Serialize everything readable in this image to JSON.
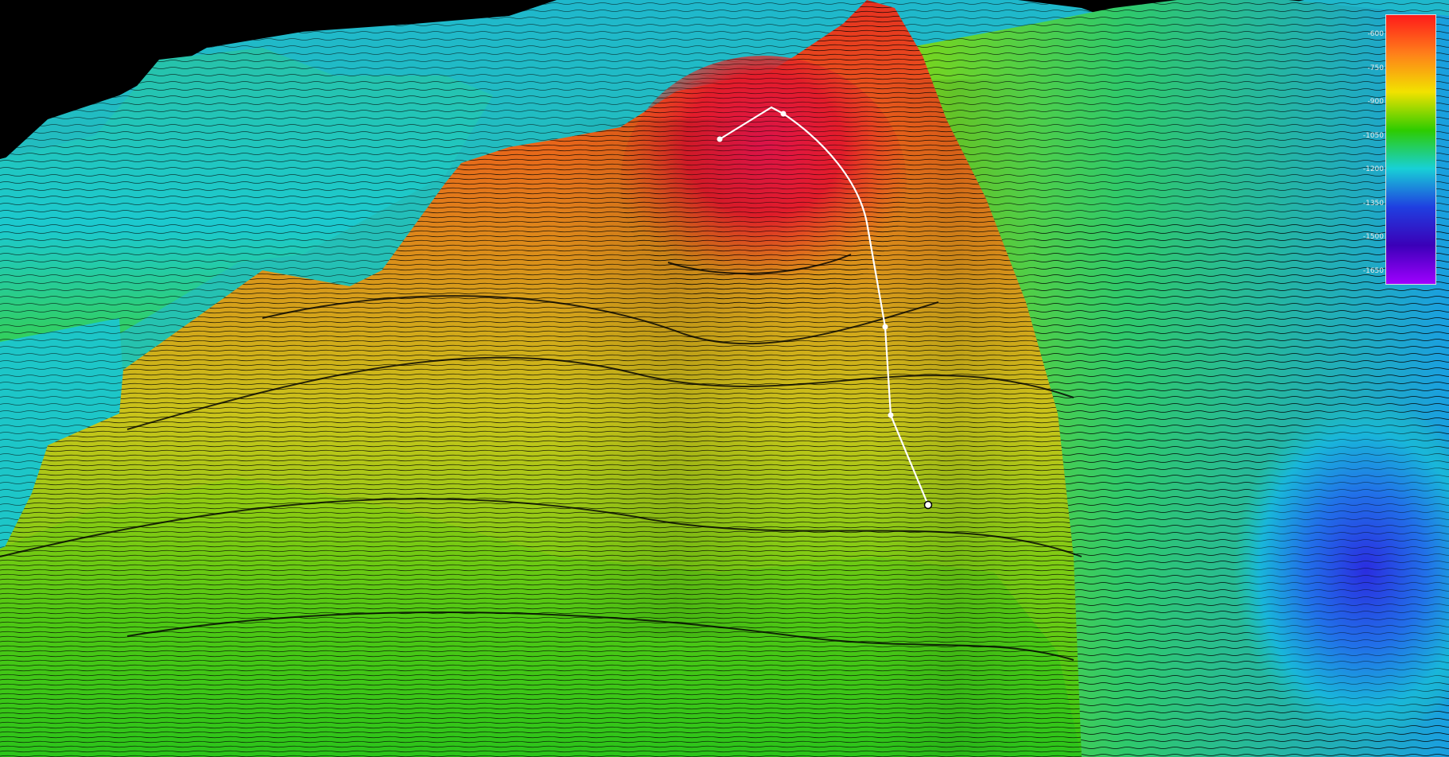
{
  "map": {
    "scene": "3d-bathymetric-terrain-with-contours",
    "colormap": [
      "#ff1a1a",
      "#ff7f1a",
      "#f2e200",
      "#2dcc00",
      "#18d0d6",
      "#1f3fe0",
      "#3b00b8",
      "#a000ff"
    ],
    "contour_color": "#000000",
    "profile_line_color": "#ffffff"
  },
  "legend": {
    "ticks": [
      "-600",
      "-750",
      "-900",
      "-1050",
      "-1200",
      "-1350",
      "-1500",
      "-1650"
    ],
    "values": [
      -600,
      -750,
      -900,
      -1050,
      -1200,
      -1350,
      -1500,
      -1650
    ]
  }
}
